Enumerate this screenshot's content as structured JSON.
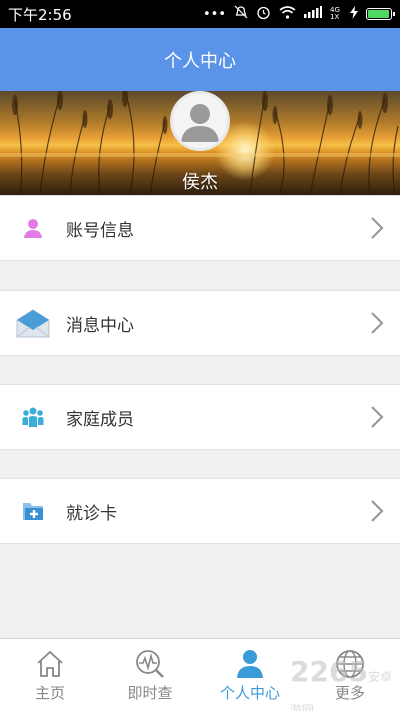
{
  "status_bar": {
    "time": "下午2:56",
    "network": "4G 1X",
    "icons": [
      "dots-icon",
      "mute-icon",
      "alarm-icon",
      "wifi-icon",
      "signal-icon",
      "charging-icon",
      "battery-icon"
    ],
    "battery_level": 0.95
  },
  "header": {
    "title": "个人中心"
  },
  "profile": {
    "username": "侯杰"
  },
  "menu": {
    "items": [
      {
        "label": "账号信息",
        "icon": "person-icon",
        "color": "#e07ce4"
      },
      {
        "label": "消息中心",
        "icon": "envelope-icon",
        "color": "#4a9ed8"
      },
      {
        "label": "家庭成员",
        "icon": "group-icon",
        "color": "#3aaed8"
      },
      {
        "label": "就诊卡",
        "icon": "medical-folder-icon",
        "color": "#3a8fd0"
      }
    ]
  },
  "bottom_nav": {
    "items": [
      {
        "label": "主页",
        "icon": "home-icon"
      },
      {
        "label": "即时查",
        "icon": "search-chart-icon"
      },
      {
        "label": "个人中心",
        "icon": "person-icon",
        "active": true
      },
      {
        "label": "更多",
        "icon": "globe-icon"
      }
    ]
  },
  "watermark": {
    "text": "2265",
    "sub": "安卓游网"
  },
  "colors": {
    "header_bg": "#5a93e8",
    "active_tab": "#3a9bd9",
    "inactive_tab": "#888888"
  }
}
